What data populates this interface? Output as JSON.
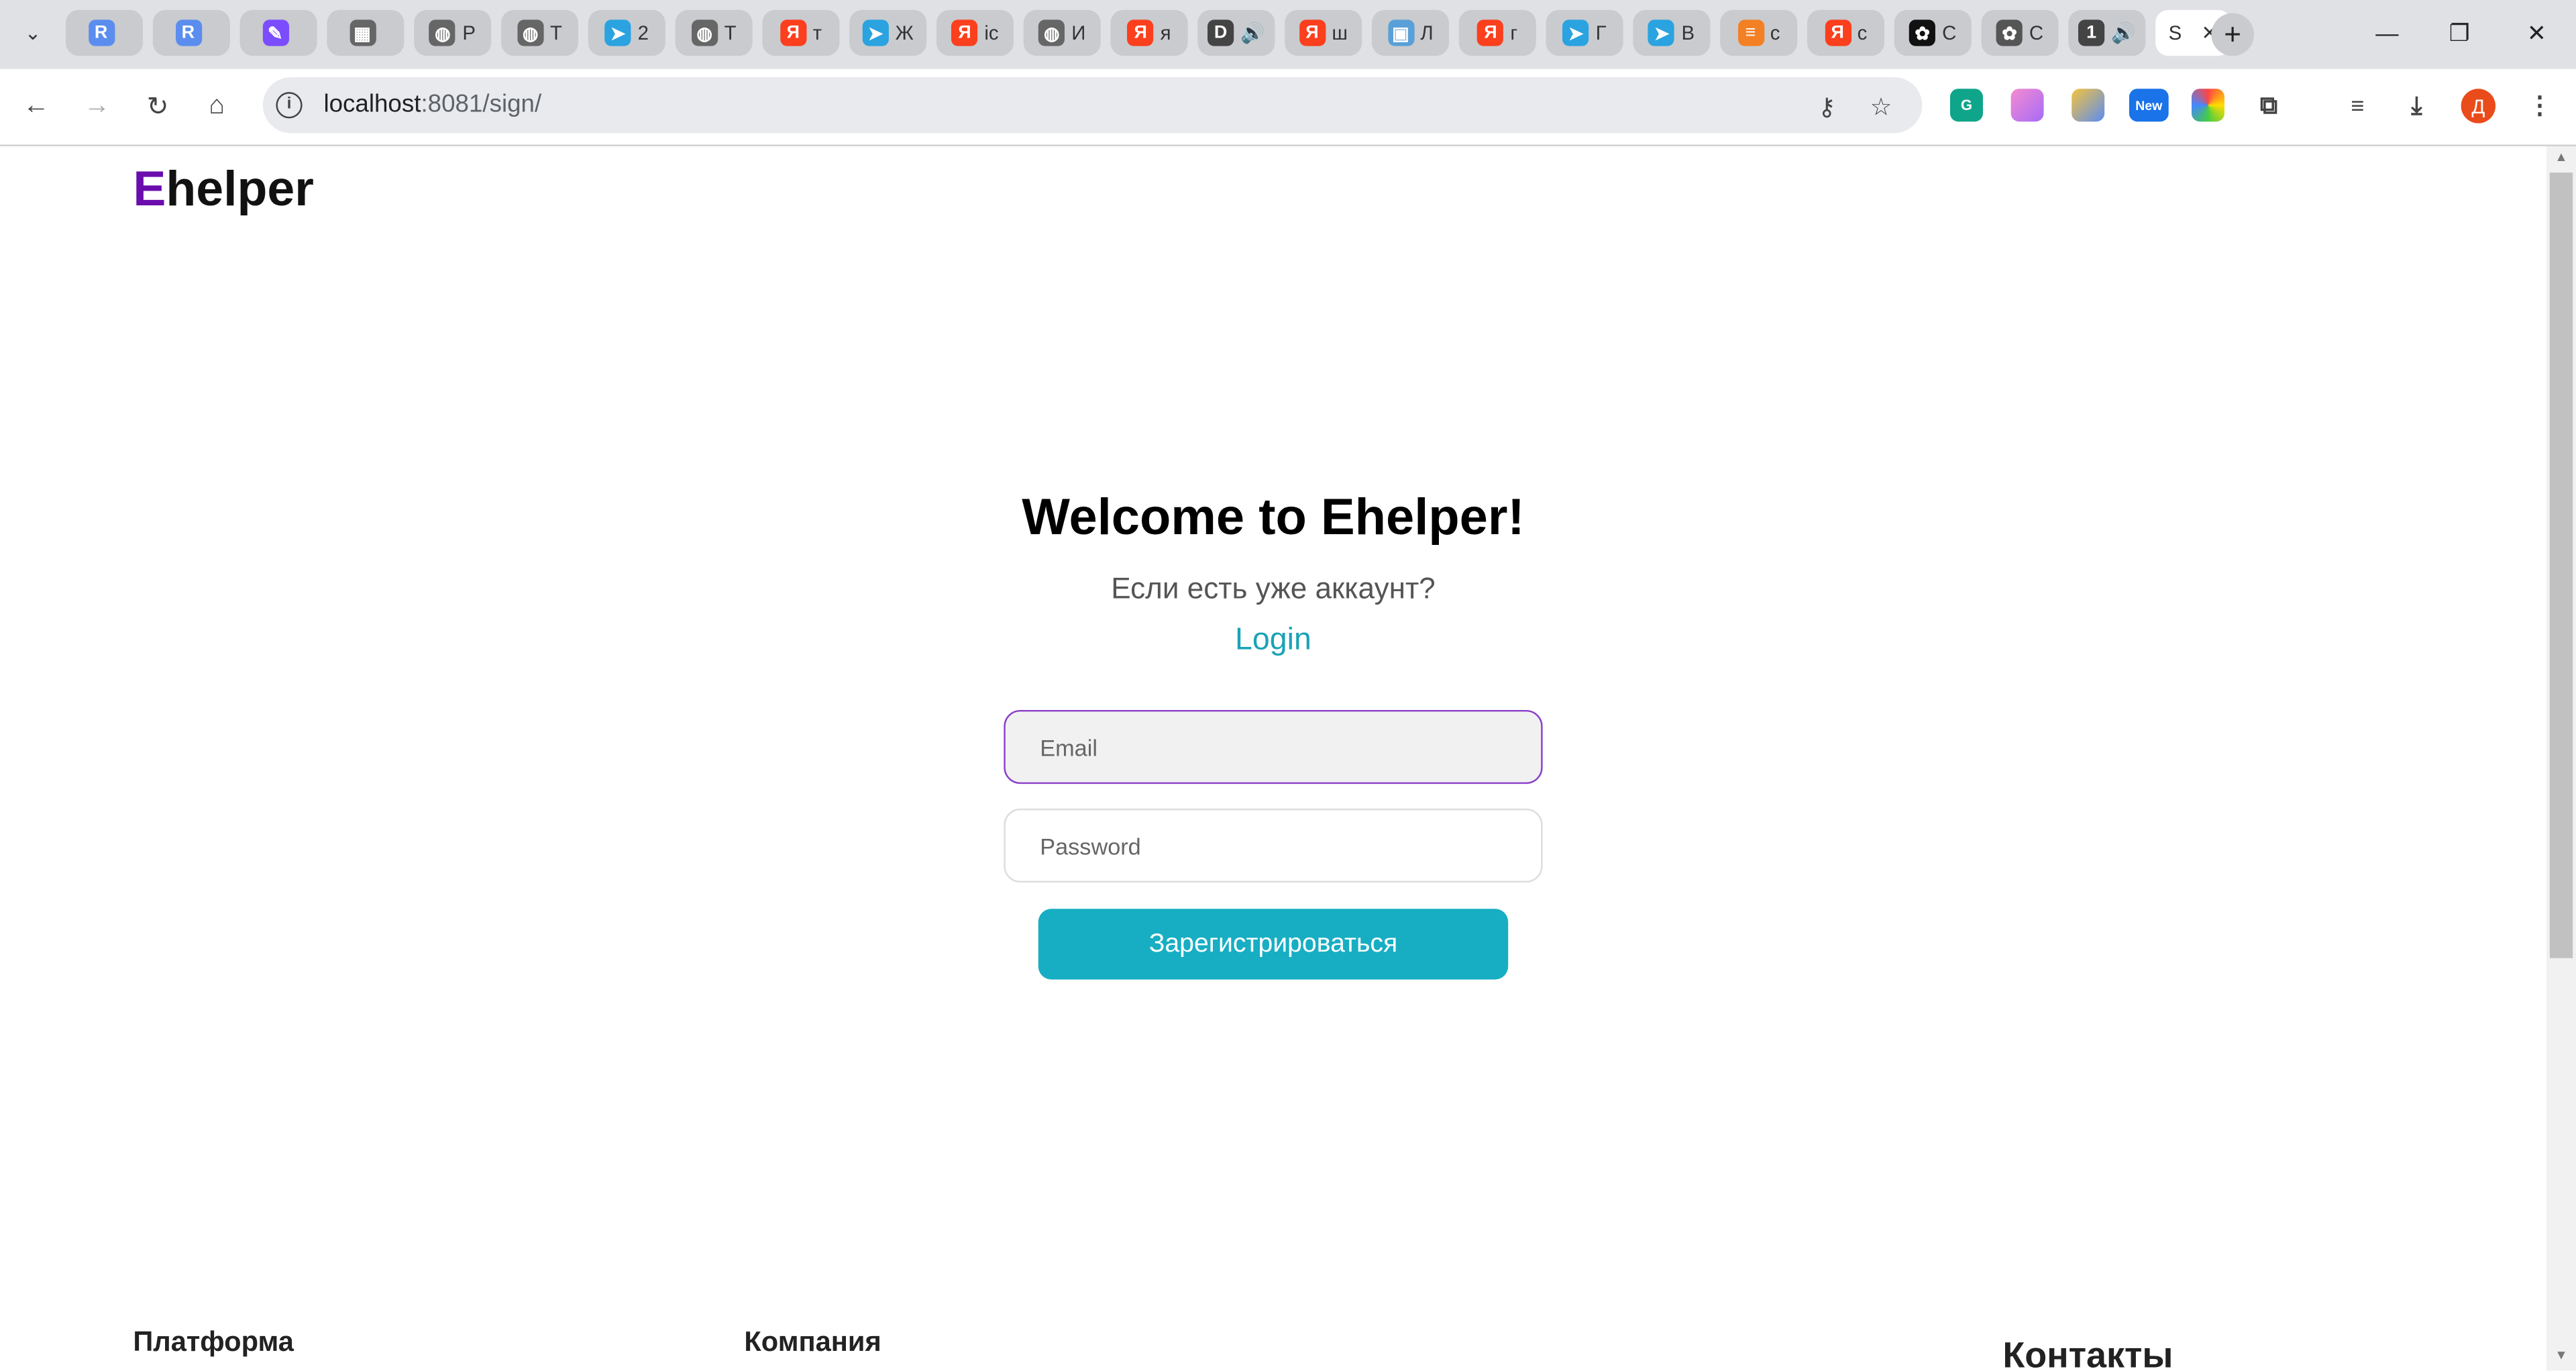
{
  "browser": {
    "tabs": [
      {
        "icon": "r-app-icon",
        "glyph": "R",
        "color": "#5b8def",
        "text": ""
      },
      {
        "icon": "r-app-icon",
        "glyph": "R",
        "color": "#5b8def",
        "text": ""
      },
      {
        "icon": "pen-app-icon",
        "glyph": "✎",
        "color": "#7c4dff",
        "text": ""
      },
      {
        "icon": "chip-icon",
        "glyph": "▦",
        "color": "#666666",
        "text": ""
      },
      {
        "icon": "globe-icon",
        "glyph": "◍",
        "color": "#666666",
        "text": "Р"
      },
      {
        "icon": "globe-icon",
        "glyph": "◍",
        "color": "#666666",
        "text": "Т"
      },
      {
        "icon": "telegram-icon",
        "glyph": "➤",
        "color": "#2aa3e0",
        "text": "2"
      },
      {
        "icon": "globe-icon",
        "glyph": "◍",
        "color": "#666666",
        "text": "Т"
      },
      {
        "icon": "yandex-icon",
        "glyph": "Я",
        "color": "#fc3f1d",
        "text": "т"
      },
      {
        "icon": "telegram-icon",
        "glyph": "➤",
        "color": "#2aa3e0",
        "text": "Ж"
      },
      {
        "icon": "yandex-icon",
        "glyph": "Я",
        "color": "#fc3f1d",
        "text": "ic"
      },
      {
        "icon": "globe-icon",
        "glyph": "◍",
        "color": "#666666",
        "text": "И"
      },
      {
        "icon": "yandex-icon",
        "glyph": "Я",
        "color": "#fc3f1d",
        "text": "я"
      },
      {
        "icon": "speaker-icon",
        "glyph": "D",
        "color": "#444444",
        "text": "🔊"
      },
      {
        "icon": "yandex-icon",
        "glyph": "Я",
        "color": "#fc3f1d",
        "text": "ш"
      },
      {
        "icon": "image-icon",
        "glyph": "▣",
        "color": "#5aa0d8",
        "text": "Л"
      },
      {
        "icon": "yandex-icon",
        "glyph": "Я",
        "color": "#fc3f1d",
        "text": "г"
      },
      {
        "icon": "telegram-icon",
        "glyph": "➤",
        "color": "#2aa3e0",
        "text": "Г"
      },
      {
        "icon": "telegram-icon",
        "glyph": "➤",
        "color": "#2aa3e0",
        "text": "В"
      },
      {
        "icon": "stackoverflow-icon",
        "glyph": "≡",
        "color": "#f48024",
        "text": "с"
      },
      {
        "icon": "yandex-icon",
        "glyph": "Я",
        "color": "#fc3f1d",
        "text": "с"
      },
      {
        "icon": "chatgpt-icon",
        "glyph": "✿",
        "color": "#111111",
        "text": "С"
      },
      {
        "icon": "chatgpt-icon",
        "glyph": "✿",
        "color": "#555555",
        "text": "С"
      },
      {
        "icon": "speaker-icon",
        "glyph": "1",
        "color": "#444444",
        "text": "🔊"
      }
    ],
    "active_tab": {
      "text": "S",
      "close": "✕"
    },
    "url_host": "localhost",
    "url_path": ":8081/sign/"
  },
  "page": {
    "logo_first": "E",
    "logo_rest": "helper",
    "title": "Welcome to Ehelper!",
    "subtitle": "Если есть уже аккаунт?",
    "login_link": "Login",
    "email_placeholder": "Email",
    "password_placeholder": "Password",
    "submit_label": "Зарегистрироваться",
    "footer": {
      "col1": "Платформа",
      "col2": "Компания",
      "col3": "Контакты"
    }
  },
  "colors": {
    "brand_purple": "#6a0dad",
    "accent_teal": "#17aec3",
    "link_teal": "#1aa3b6"
  }
}
